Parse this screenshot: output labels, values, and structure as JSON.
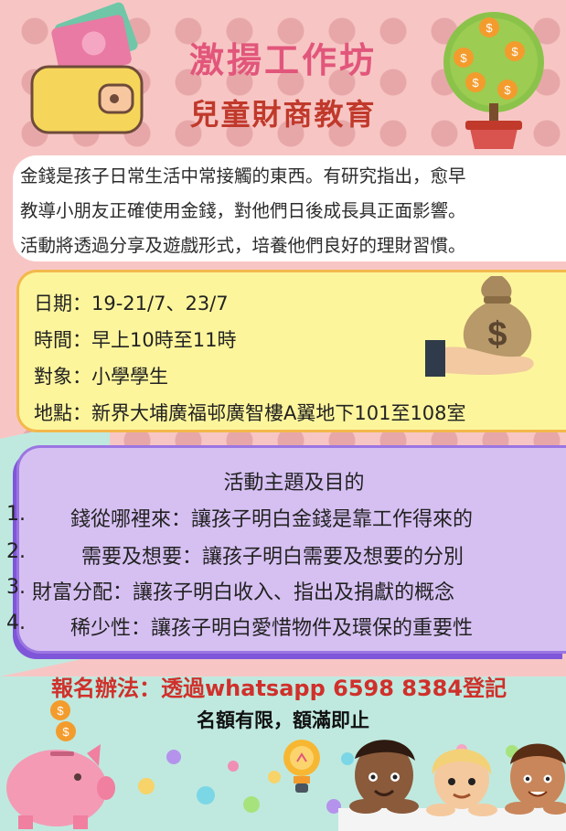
{
  "header": {
    "title": "激揚工作坊",
    "subtitle": "兒童財商教育"
  },
  "intro": {
    "lines": [
      "金錢是孩子日常生活中常接觸的東西。有研究指出，愈早",
      "教導小朋友正確使用金錢，對他們日後成長具正面影響。",
      "活動將透過分享及遊戲形式，培養他們良好的理財習慣。"
    ]
  },
  "details": {
    "date": "日期：19-21/7、23/7",
    "time": "時間：早上10時至11時",
    "audience": "對象：小學學生",
    "venue": "地點：新界大埔廣福邨廣智樓A翼地下101至108室"
  },
  "topics": {
    "heading": "活動主題及目的",
    "items": [
      {
        "num": "1.",
        "text": "錢從哪裡來：讓孩子明白金錢是靠工作得來的"
      },
      {
        "num": "2.",
        "text": "需要及想要：讓孩子明白需要及想要的分別"
      },
      {
        "num": "3.",
        "text": "財富分配：讓孩子明白收入、指出及捐獻的概念"
      },
      {
        "num": "4.",
        "text": "稀少性：讓孩子明白愛惜物件及環保的重要性"
      }
    ]
  },
  "footer": {
    "register": "報名辦法：透過whatsapp  6598  8384登記",
    "quota": "名額有限，額滿即止"
  },
  "colors": {
    "title": "#e2567b",
    "subtitle": "#c0392b",
    "info_bg": "#fdf59c",
    "topics_bg": "#d6c0f2",
    "register": "#d0302b"
  },
  "icons": [
    "wallet-icon",
    "money-tree-icon",
    "money-bag-hand-icon",
    "piggy-bank-icon",
    "light-bulb-icon",
    "children-icon"
  ]
}
